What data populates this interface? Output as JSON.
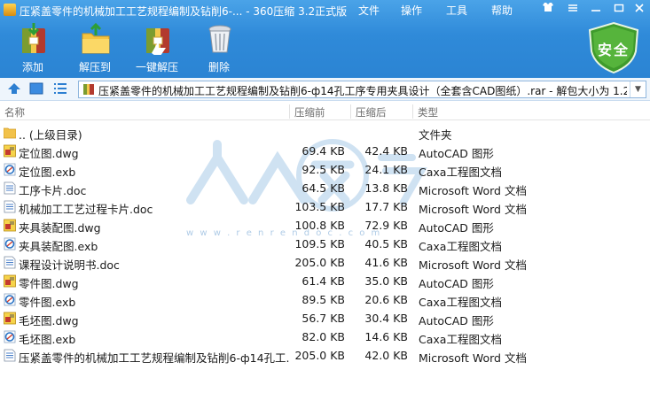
{
  "window": {
    "title": "压紧盖零件的机械加工工艺规程编制及钻削6-... - 360压缩 3.2正式版",
    "menu": [
      "文件",
      "操作",
      "工具",
      "帮助"
    ]
  },
  "toolbar": {
    "add_label": "添加",
    "extract_to_label": "解压到",
    "one_click_extract_label": "一键解压",
    "delete_label": "删除",
    "safety_badge": "安全"
  },
  "address": {
    "path": "压紧盖零件的机械加工工艺规程编制及钻削6-ф14孔工序专用夹具设计（全套含CAD图纸）.rar - 解包大小为 1.2"
  },
  "columns": {
    "name": "名称",
    "size": "压缩前",
    "packed": "压缩后",
    "type": "类型"
  },
  "files": [
    {
      "name": ".. (上级目录)",
      "size": "",
      "packed": "",
      "type": "文件夹",
      "icon": "folder-icon"
    },
    {
      "name": "定位图.dwg",
      "size": "69.4 KB",
      "packed": "42.4 KB",
      "type": "AutoCAD 图形",
      "icon": "dwg-file-icon"
    },
    {
      "name": "定位图.exb",
      "size": "92.5 KB",
      "packed": "24.1 KB",
      "type": "Caxa工程图文档",
      "icon": "exb-file-icon"
    },
    {
      "name": "工序卡片.doc",
      "size": "64.5 KB",
      "packed": "13.8 KB",
      "type": "Microsoft Word 文档",
      "icon": "doc-file-icon"
    },
    {
      "name": "机械加工工艺过程卡片.doc",
      "size": "103.5 KB",
      "packed": "17.7 KB",
      "type": "Microsoft Word 文档",
      "icon": "doc-file-icon"
    },
    {
      "name": "夹具装配图.dwg",
      "size": "100.8 KB",
      "packed": "72.9 KB",
      "type": "AutoCAD 图形",
      "icon": "dwg-file-icon"
    },
    {
      "name": "夹具装配图.exb",
      "size": "109.5 KB",
      "packed": "40.5 KB",
      "type": "Caxa工程图文档",
      "icon": "exb-file-icon"
    },
    {
      "name": "课程设计说明书.doc",
      "size": "205.0 KB",
      "packed": "41.6 KB",
      "type": "Microsoft Word 文档",
      "icon": "doc-file-icon"
    },
    {
      "name": "零件图.dwg",
      "size": "61.4 KB",
      "packed": "35.0 KB",
      "type": "AutoCAD 图形",
      "icon": "dwg-file-icon"
    },
    {
      "name": "零件图.exb",
      "size": "89.5 KB",
      "packed": "20.6 KB",
      "type": "Caxa工程图文档",
      "icon": "exb-file-icon"
    },
    {
      "name": "毛坯图.dwg",
      "size": "56.7 KB",
      "packed": "30.4 KB",
      "type": "AutoCAD 图形",
      "icon": "dwg-file-icon"
    },
    {
      "name": "毛坯图.exb",
      "size": "82.0 KB",
      "packed": "14.6 KB",
      "type": "Caxa工程图文档",
      "icon": "exb-file-icon"
    },
    {
      "name": "压紧盖零件的机械加工工艺规程编制及钻削6-ф14孔工...",
      "size": "205.0 KB",
      "packed": "42.0 KB",
      "type": "Microsoft Word 文档",
      "icon": "doc-file-icon"
    }
  ],
  "watermark": {
    "text": "人人文库",
    "url": "w w w . r e n r e n d o c . c o m"
  }
}
